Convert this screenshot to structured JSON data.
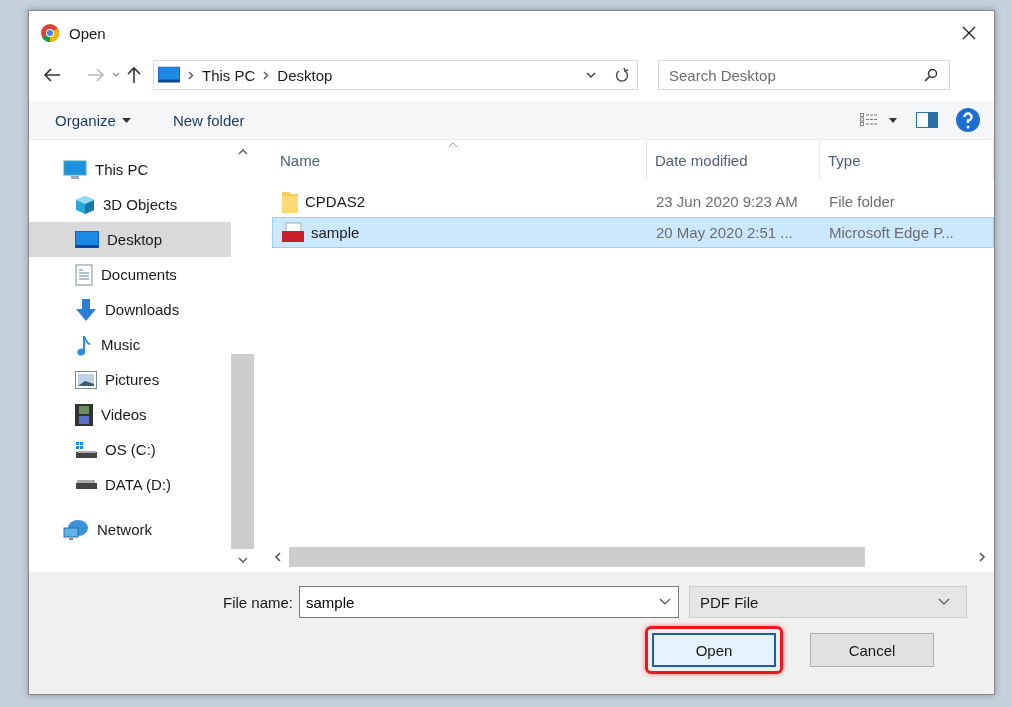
{
  "window": {
    "title": "Open"
  },
  "address": {
    "path": [
      "This PC",
      "Desktop"
    ]
  },
  "search": {
    "placeholder": "Search Desktop"
  },
  "toolbar": {
    "buttons": [
      {
        "label": "Organize",
        "kind": "menu"
      },
      {
        "label": "New folder",
        "kind": "plain"
      }
    ]
  },
  "nav_pane": {
    "items": [
      {
        "label": "This PC",
        "kind": "pc",
        "selected": false,
        "children": [
          {
            "label": "3D Objects",
            "kind": "objects3d",
            "selected": false
          },
          {
            "label": "Desktop",
            "kind": "desktop",
            "selected": true
          },
          {
            "label": "Documents",
            "kind": "documents",
            "selected": false
          },
          {
            "label": "Downloads",
            "kind": "downloads",
            "selected": false
          },
          {
            "label": "Music",
            "kind": "music",
            "selected": false
          },
          {
            "label": "Pictures",
            "kind": "pictures",
            "selected": false
          },
          {
            "label": "Videos",
            "kind": "videos",
            "selected": false
          },
          {
            "label": "OS (C:)",
            "kind": "osdrive",
            "selected": false
          },
          {
            "label": "DATA (D:)",
            "kind": "drive",
            "selected": false
          }
        ]
      },
      {
        "label": "Network",
        "kind": "network",
        "selected": false
      }
    ]
  },
  "file_list": {
    "columns": [
      "Name",
      "Date modified",
      "Type"
    ],
    "rows": [
      {
        "name": "CPDAS2",
        "date": "23 Jun 2020 9:23 AM",
        "type": "File folder",
        "kind": "folder",
        "selected": false
      },
      {
        "name": "sample",
        "date": "20 May 2020 2:51 ...",
        "type": "Microsoft Edge P...",
        "kind": "pdf",
        "selected": true
      }
    ]
  },
  "file_name": {
    "label": "File name:",
    "value": "sample"
  },
  "file_type": {
    "value": "PDF File"
  },
  "buttons": [
    {
      "label": "Open",
      "kind": "default",
      "highlighted": true
    },
    {
      "label": "Cancel",
      "kind": "normal",
      "highlighted": false
    }
  ]
}
